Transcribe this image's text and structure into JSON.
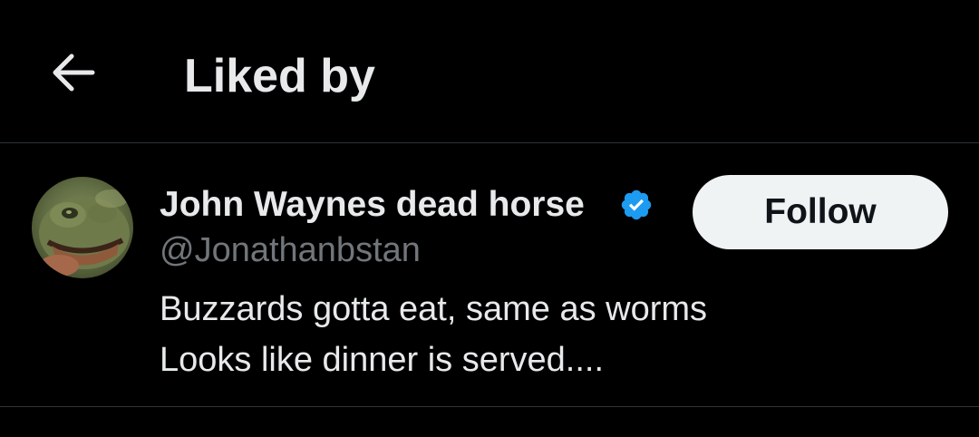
{
  "header": {
    "back_icon": "arrow-left-icon",
    "title": "Liked by"
  },
  "liked_by": [
    {
      "display_name": "John Waynes dead horse",
      "verified": true,
      "verified_icon": "verified-badge-icon",
      "verified_color": "#1d9bf0",
      "handle": "@Jonathanbstan",
      "bio_lines": [
        "Buzzards gotta eat, same as worms",
        "Looks like dinner is served...."
      ],
      "follow_label": "Follow"
    }
  ],
  "colors": {
    "background": "#000000",
    "primary_text": "#e7e9ea",
    "secondary_text": "#71767b",
    "divider": "#2f3336",
    "follow_button_bg": "#eff3f4",
    "follow_button_text": "#0f1419"
  }
}
